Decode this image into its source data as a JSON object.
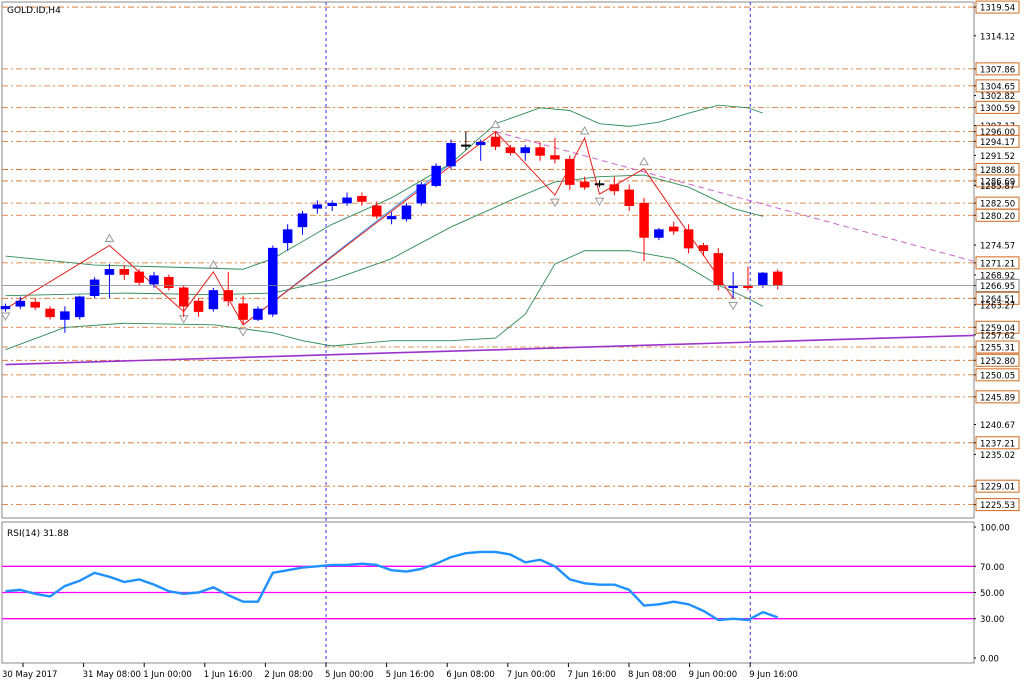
{
  "chart_data": [
    {
      "type": "candlestick",
      "title": "GOLD.ID,H4",
      "ylim": [
        1223.0,
        1320.5
      ],
      "price_levels": [
        {
          "label": "1319.54",
          "boxed": true
        },
        {
          "label": "1314.12",
          "boxed": false
        },
        {
          "label": "1307.86",
          "boxed": true
        },
        {
          "label": "1304.65",
          "boxed": true
        },
        {
          "label": "1302.82",
          "boxed": false
        },
        {
          "label": "1300.59",
          "boxed": true
        },
        {
          "label": "1297.17",
          "boxed": false
        },
        {
          "label": "1296.00",
          "boxed": true
        },
        {
          "label": "1294.17",
          "boxed": true
        },
        {
          "label": "1291.52",
          "boxed": false
        },
        {
          "label": "1288.86",
          "boxed": true
        },
        {
          "label": "1286.69",
          "boxed": true
        },
        {
          "label": "1285.87",
          "boxed": false
        },
        {
          "label": "1282.50",
          "boxed": true
        },
        {
          "label": "1280.20",
          "boxed": true
        },
        {
          "label": "1274.57",
          "boxed": false
        },
        {
          "label": "1271.21",
          "boxed": true
        },
        {
          "label": "1268.92",
          "boxed": false
        },
        {
          "label": "1266.95",
          "boxed": true,
          "current": true
        },
        {
          "label": "1264.51",
          "boxed": true
        },
        {
          "label": "1263.27",
          "boxed": false
        },
        {
          "label": "1259.04",
          "boxed": true
        },
        {
          "label": "1257.62",
          "boxed": false
        },
        {
          "label": "1255.31",
          "boxed": true
        },
        {
          "label": "1252.80",
          "boxed": true
        },
        {
          "label": "1250.05",
          "boxed": true
        },
        {
          "label": "1245.89",
          "boxed": true
        },
        {
          "label": "1240.67",
          "boxed": false
        },
        {
          "label": "1237.21",
          "boxed": true
        },
        {
          "label": "1235.02",
          "boxed": false
        },
        {
          "label": "1229.01",
          "boxed": true
        },
        {
          "label": "1225.53",
          "boxed": true
        }
      ],
      "x_ticks": [
        "30 May 2017",
        "31 May 08:00",
        "1 Jun 00:00",
        "1 Jun 16:00",
        "2 Jun 08:00",
        "5 Jun 00:00",
        "5 Jun 16:00",
        "6 Jun 08:00",
        "7 Jun 00:00",
        "7 Jun 16:00",
        "8 Jun 08:00",
        "9 Jun 00:00",
        "9 Jun 16:00"
      ],
      "session_separators": [
        "5 Jun 00:00",
        "9 Jun 16:00"
      ],
      "candles": [
        {
          "o": 1262.5,
          "h": 1263.5,
          "l": 1262.0,
          "c": 1263.0
        },
        {
          "o": 1263.0,
          "h": 1264.8,
          "l": 1262.5,
          "c": 1264.0
        },
        {
          "o": 1263.8,
          "h": 1264.5,
          "l": 1262.3,
          "c": 1262.8
        },
        {
          "o": 1262.5,
          "h": 1263.0,
          "l": 1260.5,
          "c": 1261.0
        },
        {
          "o": 1260.5,
          "h": 1263.0,
          "l": 1258.0,
          "c": 1262.0
        },
        {
          "o": 1261.0,
          "h": 1265.0,
          "l": 1260.5,
          "c": 1264.8
        },
        {
          "o": 1265.0,
          "h": 1268.5,
          "l": 1264.5,
          "c": 1268.0
        },
        {
          "o": 1269.0,
          "h": 1271.0,
          "l": 1264.5,
          "c": 1270.0
        },
        {
          "o": 1270.0,
          "h": 1270.8,
          "l": 1268.0,
          "c": 1269.0
        },
        {
          "o": 1269.5,
          "h": 1270.0,
          "l": 1267.0,
          "c": 1267.5
        },
        {
          "o": 1267.2,
          "h": 1269.5,
          "l": 1266.5,
          "c": 1268.8
        },
        {
          "o": 1268.5,
          "h": 1269.0,
          "l": 1266.0,
          "c": 1266.5
        },
        {
          "o": 1266.5,
          "h": 1267.0,
          "l": 1261.0,
          "c": 1263.0
        },
        {
          "o": 1264.0,
          "h": 1264.5,
          "l": 1261.0,
          "c": 1262.0
        },
        {
          "o": 1262.5,
          "h": 1266.5,
          "l": 1262.0,
          "c": 1266.0
        },
        {
          "o": 1266.0,
          "h": 1269.5,
          "l": 1263.0,
          "c": 1264.0
        },
        {
          "o": 1263.5,
          "h": 1265.0,
          "l": 1259.5,
          "c": 1260.5
        },
        {
          "o": 1260.5,
          "h": 1263.0,
          "l": 1260.2,
          "c": 1262.5
        },
        {
          "o": 1261.5,
          "h": 1274.5,
          "l": 1261.0,
          "c": 1274.0
        },
        {
          "o": 1275.0,
          "h": 1278.5,
          "l": 1273.5,
          "c": 1277.5
        },
        {
          "o": 1278.0,
          "h": 1281.0,
          "l": 1276.5,
          "c": 1280.5
        },
        {
          "o": 1281.5,
          "h": 1283.0,
          "l": 1280.5,
          "c": 1282.2
        },
        {
          "o": 1282.0,
          "h": 1283.0,
          "l": 1281.0,
          "c": 1282.5
        },
        {
          "o": 1282.5,
          "h": 1284.5,
          "l": 1282.0,
          "c": 1283.5
        },
        {
          "o": 1283.8,
          "h": 1284.5,
          "l": 1282.0,
          "c": 1282.8
        },
        {
          "o": 1282.0,
          "h": 1282.8,
          "l": 1279.5,
          "c": 1280.0
        },
        {
          "o": 1279.5,
          "h": 1280.8,
          "l": 1278.5,
          "c": 1280.0
        },
        {
          "o": 1279.5,
          "h": 1282.5,
          "l": 1279.0,
          "c": 1282.0
        },
        {
          "o": 1282.5,
          "h": 1286.5,
          "l": 1282.0,
          "c": 1286.0
        },
        {
          "o": 1285.8,
          "h": 1290.0,
          "l": 1285.5,
          "c": 1289.5
        },
        {
          "o": 1289.5,
          "h": 1294.5,
          "l": 1289.0,
          "c": 1293.8
        },
        {
          "o": 1293.5,
          "h": 1296.0,
          "l": 1292.5,
          "c": 1293.5
        },
        {
          "o": 1293.5,
          "h": 1294.5,
          "l": 1290.5,
          "c": 1294.0
        },
        {
          "o": 1295.0,
          "h": 1296.0,
          "l": 1292.5,
          "c": 1293.2
        },
        {
          "o": 1293.0,
          "h": 1293.5,
          "l": 1291.5,
          "c": 1292.0
        },
        {
          "o": 1292.0,
          "h": 1293.5,
          "l": 1290.5,
          "c": 1293.0
        },
        {
          "o": 1293.0,
          "h": 1294.0,
          "l": 1290.5,
          "c": 1291.5
        },
        {
          "o": 1291.5,
          "h": 1294.8,
          "l": 1290.0,
          "c": 1290.8
        },
        {
          "o": 1290.8,
          "h": 1291.5,
          "l": 1285.0,
          "c": 1286.0
        },
        {
          "o": 1286.5,
          "h": 1287.5,
          "l": 1285.0,
          "c": 1285.5
        },
        {
          "o": 1286.0,
          "h": 1286.8,
          "l": 1285.5,
          "c": 1286.2
        },
        {
          "o": 1286.0,
          "h": 1287.5,
          "l": 1284.0,
          "c": 1284.8
        },
        {
          "o": 1285.0,
          "h": 1286.0,
          "l": 1281.0,
          "c": 1282.0
        },
        {
          "o": 1282.5,
          "h": 1283.5,
          "l": 1271.5,
          "c": 1276.0
        },
        {
          "o": 1276.0,
          "h": 1277.8,
          "l": 1275.5,
          "c": 1277.5
        },
        {
          "o": 1278.0,
          "h": 1279.0,
          "l": 1276.5,
          "c": 1277.2
        },
        {
          "o": 1277.5,
          "h": 1278.5,
          "l": 1273.0,
          "c": 1274.0
        },
        {
          "o": 1274.5,
          "h": 1275.0,
          "l": 1272.5,
          "c": 1273.5
        },
        {
          "o": 1273.0,
          "h": 1274.0,
          "l": 1266.0,
          "c": 1267.0
        },
        {
          "o": 1266.5,
          "h": 1269.5,
          "l": 1264.5,
          "c": 1266.8
        },
        {
          "o": 1266.8,
          "h": 1270.5,
          "l": 1266.0,
          "c": 1266.5
        },
        {
          "o": 1267.0,
          "h": 1269.5,
          "l": 1266.5,
          "c": 1269.3
        },
        {
          "o": 1269.5,
          "h": 1270.0,
          "l": 1266.2,
          "c": 1266.95
        }
      ],
      "zigzag_points": [
        [
          0,
          1262.5
        ],
        [
          7,
          1274.5
        ],
        [
          12,
          1262.0
        ],
        [
          14,
          1269.5
        ],
        [
          16,
          1259.5
        ],
        [
          33,
          1296.0
        ],
        [
          37,
          1284.0
        ],
        [
          39,
          1294.8
        ],
        [
          40,
          1284.2
        ],
        [
          43,
          1289.0
        ],
        [
          49,
          1264.5
        ]
      ],
      "bollinger": {
        "upper": [
          [
            0,
            1272.5
          ],
          [
            6,
            1270.8
          ],
          [
            10,
            1270.5
          ],
          [
            16,
            1270.0
          ],
          [
            18,
            1272.0
          ],
          [
            22,
            1278.5
          ],
          [
            26,
            1283.5
          ],
          [
            30,
            1290.0
          ],
          [
            33,
            1297.5
          ],
          [
            36,
            1300.5
          ],
          [
            38,
            1300.0
          ],
          [
            40,
            1297.5
          ],
          [
            42,
            1297.0
          ],
          [
            44,
            1297.8
          ],
          [
            46,
            1299.5
          ],
          [
            48,
            1301.0
          ],
          [
            50,
            1300.5
          ],
          [
            51,
            1299.5
          ]
        ],
        "middle": [
          [
            0,
            1265.0
          ],
          [
            8,
            1265.5
          ],
          [
            14,
            1265.2
          ],
          [
            18,
            1265.5
          ],
          [
            22,
            1268.0
          ],
          [
            26,
            1272.0
          ],
          [
            30,
            1278.0
          ],
          [
            34,
            1283.0
          ],
          [
            37,
            1286.5
          ],
          [
            40,
            1287.5
          ],
          [
            43,
            1287.8
          ],
          [
            46,
            1285.5
          ],
          [
            49,
            1281.5
          ],
          [
            51,
            1280.0
          ]
        ],
        "lower": [
          [
            0,
            1254.8
          ],
          [
            4,
            1259.0
          ],
          [
            8,
            1259.8
          ],
          [
            14,
            1259.5
          ],
          [
            18,
            1258.0
          ],
          [
            20,
            1256.5
          ],
          [
            22,
            1255.5
          ],
          [
            26,
            1256.5
          ],
          [
            30,
            1256.5
          ],
          [
            33,
            1257.0
          ],
          [
            35,
            1261.5
          ],
          [
            37,
            1271.0
          ],
          [
            39,
            1273.5
          ],
          [
            42,
            1273.5
          ],
          [
            45,
            1272.0
          ],
          [
            48,
            1267.0
          ],
          [
            50,
            1264.5
          ],
          [
            51,
            1263.0
          ]
        ]
      },
      "trendlines": [
        {
          "name": "support",
          "points": [
            [
              0,
              1252.0
            ],
            [
              54,
              1257.5
            ]
          ],
          "color": "#9933cc",
          "style": "solid"
        },
        {
          "name": "resistance",
          "points": [
            [
              33,
              1296.0
            ],
            [
              54,
              1271.5
            ]
          ],
          "color": "#cc66cc",
          "style": "dashed"
        },
        {
          "name": "channel",
          "points": [
            [
              16,
              1259.5
            ],
            [
              30,
              1290.0
            ]
          ],
          "color": "#3399ff",
          "style": "solid"
        }
      ],
      "colors": {
        "bull": "#0000ff",
        "bear": "#ff0000",
        "doji": "#000000",
        "bollinger": "#2e8b57",
        "zigzag": "#e8201c",
        "level": "#d2691e",
        "separator": "#0000ff"
      }
    },
    {
      "type": "line",
      "title": "RSI(14) 31.88",
      "ylim": [
        0,
        100
      ],
      "tick_labels": [
        "100.00",
        "70.00",
        "50.00",
        "30.00",
        "0.00"
      ],
      "levels": [
        70,
        50,
        30
      ],
      "series": [
        {
          "values": [
            51,
            52,
            49,
            47,
            55,
            59,
            65,
            62,
            58,
            60,
            56,
            51,
            49,
            50,
            54,
            48,
            43,
            43,
            65,
            67,
            69,
            70,
            71,
            71,
            72,
            71,
            67,
            66,
            68,
            72,
            77,
            80,
            81,
            81,
            79,
            73,
            75,
            70,
            60,
            57,
            56,
            56,
            52,
            40,
            41,
            43,
            41,
            36,
            29,
            30,
            29,
            35,
            31
          ]
        }
      ],
      "colors": {
        "line": "#1e90ff",
        "levels": "#ff00ff"
      }
    }
  ]
}
